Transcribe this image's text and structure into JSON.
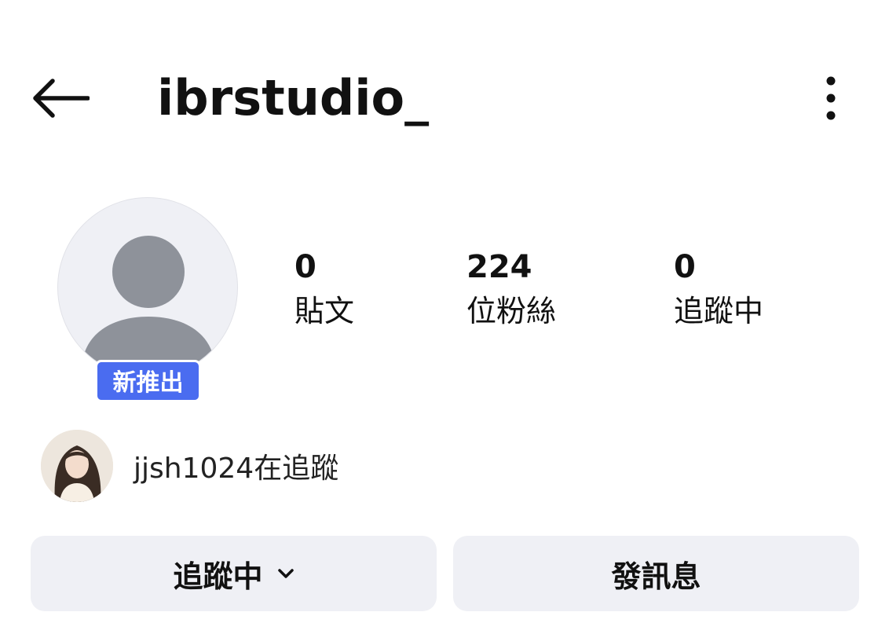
{
  "header": {
    "back_icon": "arrow-left-icon",
    "username": "ibrstudio_",
    "more_icon": "more-vertical-icon"
  },
  "profile": {
    "avatar_icon": "default-avatar-icon",
    "badge": "新推出"
  },
  "stats": [
    {
      "value": "0",
      "label": "貼文"
    },
    {
      "value": "224",
      "label": "位粉絲"
    },
    {
      "value": "0",
      "label": "追蹤中"
    }
  ],
  "followed_by": {
    "text": "jjsh1024在追蹤"
  },
  "actions": {
    "following_label": "追蹤中",
    "following_icon": "chevron-down-icon",
    "message_label": "發訊息"
  },
  "colors": {
    "badge_bg": "#4a6cf0",
    "button_bg": "#eff0f5",
    "avatar_bg": "#eff0f5",
    "avatar_figure": "#8e929a"
  }
}
